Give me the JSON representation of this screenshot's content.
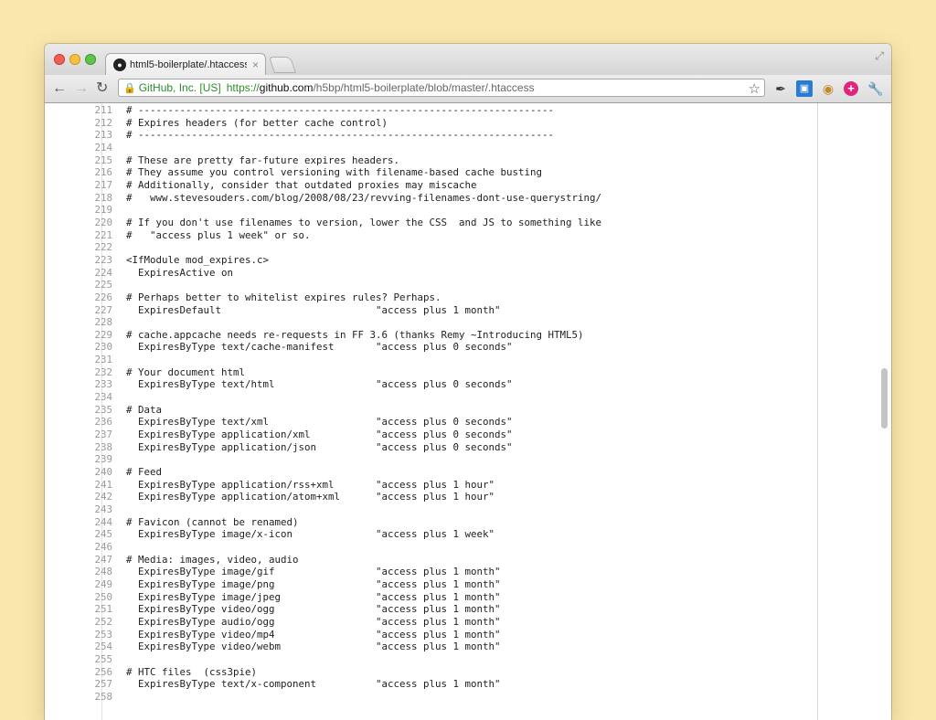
{
  "browser": {
    "tab_title": "html5-boilerplate/.htaccess",
    "tab_icon": "github-octocat-icon",
    "ev_badge": "GitHub, Inc. [US]",
    "url_scheme": "https://",
    "url_host": "github.com",
    "url_path": "/h5bp/html5-boilerplate/blob/master/.htaccess"
  },
  "colors": {
    "background": "#f9e7ad",
    "secure_green": "#2d8c2a"
  },
  "code_lines": [
    {
      "n": "211",
      "t": "# ----------------------------------------------------------------------"
    },
    {
      "n": "212",
      "t": "# Expires headers (for better cache control)"
    },
    {
      "n": "213",
      "t": "# ----------------------------------------------------------------------"
    },
    {
      "n": "214",
      "t": ""
    },
    {
      "n": "215",
      "t": "# These are pretty far-future expires headers."
    },
    {
      "n": "216",
      "t": "# They assume you control versioning with filename-based cache busting"
    },
    {
      "n": "217",
      "t": "# Additionally, consider that outdated proxies may miscache"
    },
    {
      "n": "218",
      "t": "#   www.stevesouders.com/blog/2008/08/23/revving-filenames-dont-use-querystring/"
    },
    {
      "n": "219",
      "t": ""
    },
    {
      "n": "220",
      "t": "# If you don't use filenames to version, lower the CSS  and JS to something like"
    },
    {
      "n": "221",
      "t": "#   \"access plus 1 week\" or so."
    },
    {
      "n": "222",
      "t": ""
    },
    {
      "n": "223",
      "t": "<IfModule mod_expires.c>"
    },
    {
      "n": "224",
      "t": "  ExpiresActive on"
    },
    {
      "n": "225",
      "t": ""
    },
    {
      "n": "226",
      "t": "# Perhaps better to whitelist expires rules? Perhaps."
    },
    {
      "n": "227",
      "t": "  ExpiresDefault                          \"access plus 1 month\""
    },
    {
      "n": "228",
      "t": ""
    },
    {
      "n": "229",
      "t": "# cache.appcache needs re-requests in FF 3.6 (thanks Remy ~Introducing HTML5)"
    },
    {
      "n": "230",
      "t": "  ExpiresByType text/cache-manifest       \"access plus 0 seconds\""
    },
    {
      "n": "231",
      "t": ""
    },
    {
      "n": "232",
      "t": "# Your document html"
    },
    {
      "n": "233",
      "t": "  ExpiresByType text/html                 \"access plus 0 seconds\""
    },
    {
      "n": "234",
      "t": ""
    },
    {
      "n": "235",
      "t": "# Data"
    },
    {
      "n": "236",
      "t": "  ExpiresByType text/xml                  \"access plus 0 seconds\""
    },
    {
      "n": "237",
      "t": "  ExpiresByType application/xml           \"access plus 0 seconds\""
    },
    {
      "n": "238",
      "t": "  ExpiresByType application/json          \"access plus 0 seconds\""
    },
    {
      "n": "239",
      "t": ""
    },
    {
      "n": "240",
      "t": "# Feed"
    },
    {
      "n": "241",
      "t": "  ExpiresByType application/rss+xml       \"access plus 1 hour\""
    },
    {
      "n": "242",
      "t": "  ExpiresByType application/atom+xml      \"access plus 1 hour\""
    },
    {
      "n": "243",
      "t": ""
    },
    {
      "n": "244",
      "t": "# Favicon (cannot be renamed)"
    },
    {
      "n": "245",
      "t": "  ExpiresByType image/x-icon              \"access plus 1 week\""
    },
    {
      "n": "246",
      "t": ""
    },
    {
      "n": "247",
      "t": "# Media: images, video, audio"
    },
    {
      "n": "248",
      "t": "  ExpiresByType image/gif                 \"access plus 1 month\""
    },
    {
      "n": "249",
      "t": "  ExpiresByType image/png                 \"access plus 1 month\""
    },
    {
      "n": "250",
      "t": "  ExpiresByType image/jpeg                \"access plus 1 month\""
    },
    {
      "n": "251",
      "t": "  ExpiresByType video/ogg                 \"access plus 1 month\""
    },
    {
      "n": "252",
      "t": "  ExpiresByType audio/ogg                 \"access plus 1 month\""
    },
    {
      "n": "253",
      "t": "  ExpiresByType video/mp4                 \"access plus 1 month\""
    },
    {
      "n": "254",
      "t": "  ExpiresByType video/webm                \"access plus 1 month\""
    },
    {
      "n": "255",
      "t": ""
    },
    {
      "n": "256",
      "t": "# HTC files  (css3pie)"
    },
    {
      "n": "257",
      "t": "  ExpiresByType text/x-component          \"access plus 1 month\""
    },
    {
      "n": "258",
      "t": ""
    }
  ]
}
